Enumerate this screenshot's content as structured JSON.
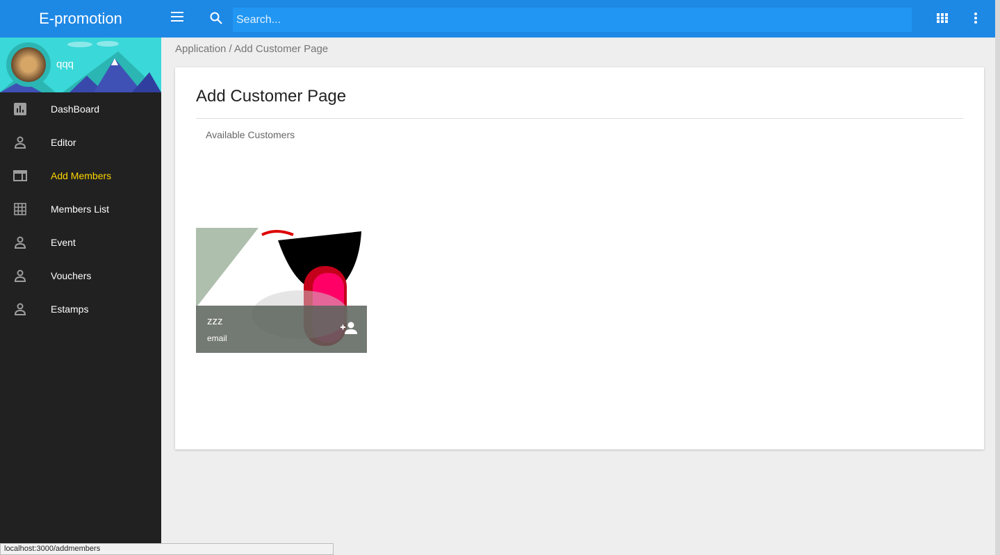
{
  "app": {
    "title": "E-promotion"
  },
  "user": {
    "name": "qqq"
  },
  "sidebar": {
    "items": [
      {
        "label": "DashBoard",
        "icon": "chart-icon"
      },
      {
        "label": "Editor",
        "icon": "person-icon"
      },
      {
        "label": "Add Members",
        "icon": "web-icon",
        "active": true
      },
      {
        "label": "Members List",
        "icon": "grid-icon"
      },
      {
        "label": "Event",
        "icon": "person-icon"
      },
      {
        "label": "Vouchers",
        "icon": "person-icon"
      },
      {
        "label": "Estamps",
        "icon": "person-icon"
      }
    ]
  },
  "topbar": {
    "search_placeholder": "Search..."
  },
  "breadcrumb": "Application / Add Customer Page",
  "page": {
    "title": "Add Customer Page",
    "subtitle": "Available Customers",
    "customers": [
      {
        "name": "zzz",
        "email": "email"
      }
    ]
  },
  "status_bar": "localhost:3000/addmembers",
  "colors": {
    "primary": "#1e88e5",
    "active": "#ffd600",
    "sidebar": "#212121"
  }
}
